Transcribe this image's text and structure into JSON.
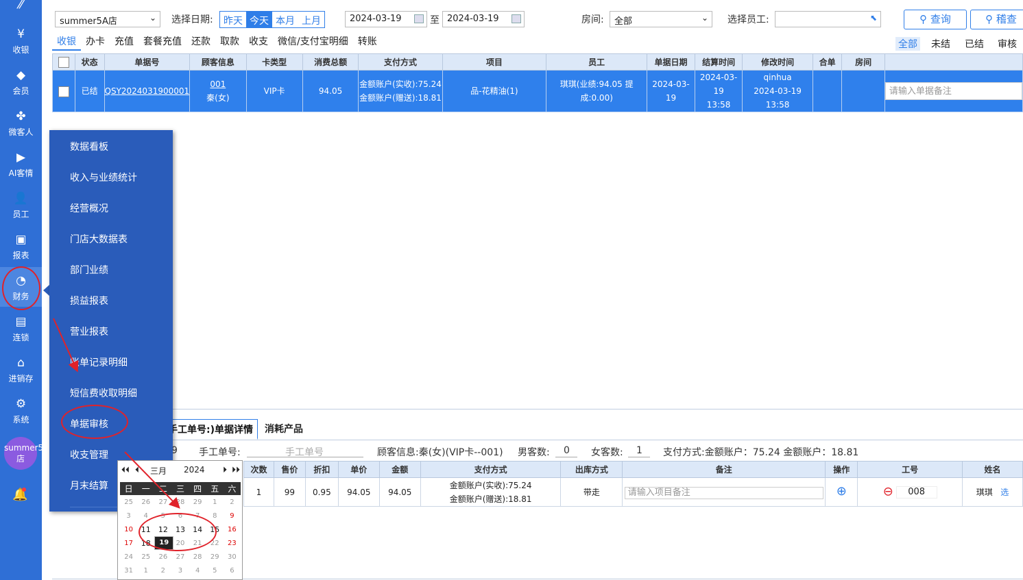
{
  "sidebar": {
    "items": [
      {
        "label": "收银",
        "icon": "yen-icon"
      },
      {
        "label": "会员",
        "icon": "diamond-icon"
      },
      {
        "label": "微客人",
        "icon": "clover-icon"
      },
      {
        "label": "AI客情",
        "icon": "play-icon"
      },
      {
        "label": "员工",
        "icon": "user-icon"
      },
      {
        "label": "报表",
        "icon": "monitor-icon"
      },
      {
        "label": "财务",
        "icon": "pie-chart-icon"
      },
      {
        "label": "连锁",
        "icon": "store-icon"
      },
      {
        "label": "进销存",
        "icon": "warehouse-icon"
      },
      {
        "label": "系统",
        "icon": "gear-icon"
      }
    ],
    "avatar": "summer5A店"
  },
  "toolbar": {
    "store": "summer5A店",
    "date_label": "选择日期:",
    "date_ranges": [
      "昨天",
      "今天",
      "本月",
      "上月"
    ],
    "date_from": "2024-03-19",
    "date_to_label": "至",
    "date_to": "2024-03-19",
    "room_label": "房间:",
    "room_value": "全部",
    "staff_label": "选择员工:",
    "query_button": "查询",
    "audit_button": "稽查"
  },
  "tabs": [
    "收银",
    "办卡",
    "充值",
    "套餐充值",
    "还款",
    "取款",
    "收支",
    "微信/支付宝明细",
    "转账"
  ],
  "filters": [
    "全部",
    "未结",
    "已结",
    "审核"
  ],
  "grid": {
    "headers": [
      "状态",
      "单据号",
      "顾客信息",
      "卡类型",
      "消费总额",
      "支付方式",
      "项目",
      "员工",
      "单据日期",
      "结算时间",
      "修改时间",
      "合单",
      "房间"
    ],
    "row": {
      "status": "已结",
      "doc_no": "QSY2024031900001",
      "customer_no": "001",
      "customer_name": "秦(女)",
      "card_type": "VIP卡",
      "total": "94.05",
      "pay_1": "金额账户(实收):75.24",
      "pay_2": "金额账户(赠送):18.81",
      "item": "品-花精油(1)",
      "staff": "琪琪(业绩:94.05 提成:0.00)",
      "doc_date": "2024-03-19",
      "settle_date": "2024-03-19",
      "settle_time": "13:58",
      "modifier": "qinhua",
      "modify_time": "2024-03-19 13:58",
      "remark_placeholder": "请输入单据备注"
    }
  },
  "menu": {
    "items": [
      "数据看板",
      "收入与业绩统计",
      "经营概况",
      "门店大数据表",
      "部门业绩",
      "损益报表",
      "营业报表",
      "账单记录明细",
      "短信费收取明细",
      "单据审核",
      "收支管理",
      "月末结算"
    ]
  },
  "detail": {
    "tab_active": "手工单号:)单据详情",
    "tab_other": "消耗产品",
    "prefix": "9",
    "manual_no_label": "手工单号:",
    "manual_no_placeholder": "手工单号",
    "customer_info": "顾客信息:秦(女)(VIP卡--001)",
    "male_label": "男客数:",
    "male_count": "0",
    "female_label": "女客数:",
    "female_count": "1",
    "pay_info": "支付方式:金额账户：75.24  金额账户：18.81",
    "headers": [
      "次数",
      "售价",
      "折扣",
      "单价",
      "金额",
      "支付方式",
      "出库方式",
      "备注",
      "操作",
      "工号",
      "姓名"
    ],
    "row": {
      "count": "1",
      "price": "99",
      "discount": "0.95",
      "unit": "94.05",
      "amount": "94.05",
      "pay_1": "金额账户(实收):75.24",
      "pay_2": "金额账户(赠送):18.81",
      "outbound": "带走",
      "remark_placeholder": "请输入项目备注",
      "staff_no": "008",
      "staff_name": "琪琪",
      "select": "选"
    }
  },
  "calendar": {
    "month": "三月",
    "year": "2024",
    "weekdays": [
      "日",
      "一",
      "二",
      "三",
      "四",
      "五",
      "六"
    ],
    "weeks": [
      [
        "25",
        "26",
        "27",
        "28",
        "29",
        "1",
        "2"
      ],
      [
        "3",
        "4",
        "5",
        "6",
        "7",
        "8",
        "9"
      ],
      [
        "10",
        "11",
        "12",
        "13",
        "14",
        "15",
        "16"
      ],
      [
        "17",
        "18",
        "19",
        "20",
        "21",
        "22",
        "23"
      ],
      [
        "24",
        "25",
        "26",
        "27",
        "28",
        "29",
        "30"
      ],
      [
        "31",
        "1",
        "2",
        "3",
        "4",
        "5",
        "6"
      ]
    ],
    "selected": "19"
  },
  "colors": {
    "primary": "#2f7ee8",
    "sidebar": "#2f6fd6",
    "menu": "#2a5cba",
    "annotation": "#e0222a"
  }
}
